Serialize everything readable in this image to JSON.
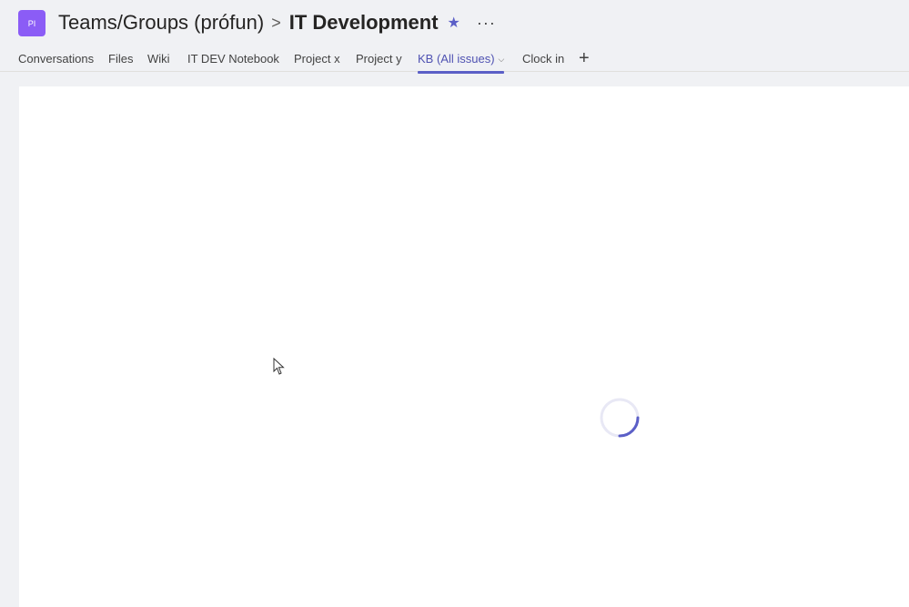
{
  "header": {
    "avatar_initials": "PI",
    "breadcrumb_parent": "Teams/Groups (prófun)",
    "breadcrumb_separator": ">",
    "breadcrumb_current": "IT Development",
    "favorite_icon": "★",
    "more_icon": "···"
  },
  "tabs": [
    {
      "label": "Conversations"
    },
    {
      "label": "Files"
    },
    {
      "label": "Wiki"
    },
    {
      "label": "IT DEV Notebook"
    },
    {
      "label": "Project x"
    },
    {
      "label": "Project y"
    },
    {
      "label": "KB (All issues)",
      "active": true,
      "chevron": "⌵"
    },
    {
      "label": "Clock in"
    }
  ],
  "add_tab_icon": "+",
  "content": {
    "state": "loading"
  },
  "colors": {
    "accent": "#5b5fc7",
    "avatar": "#8b5cf6",
    "background": "#f0f1f4"
  }
}
